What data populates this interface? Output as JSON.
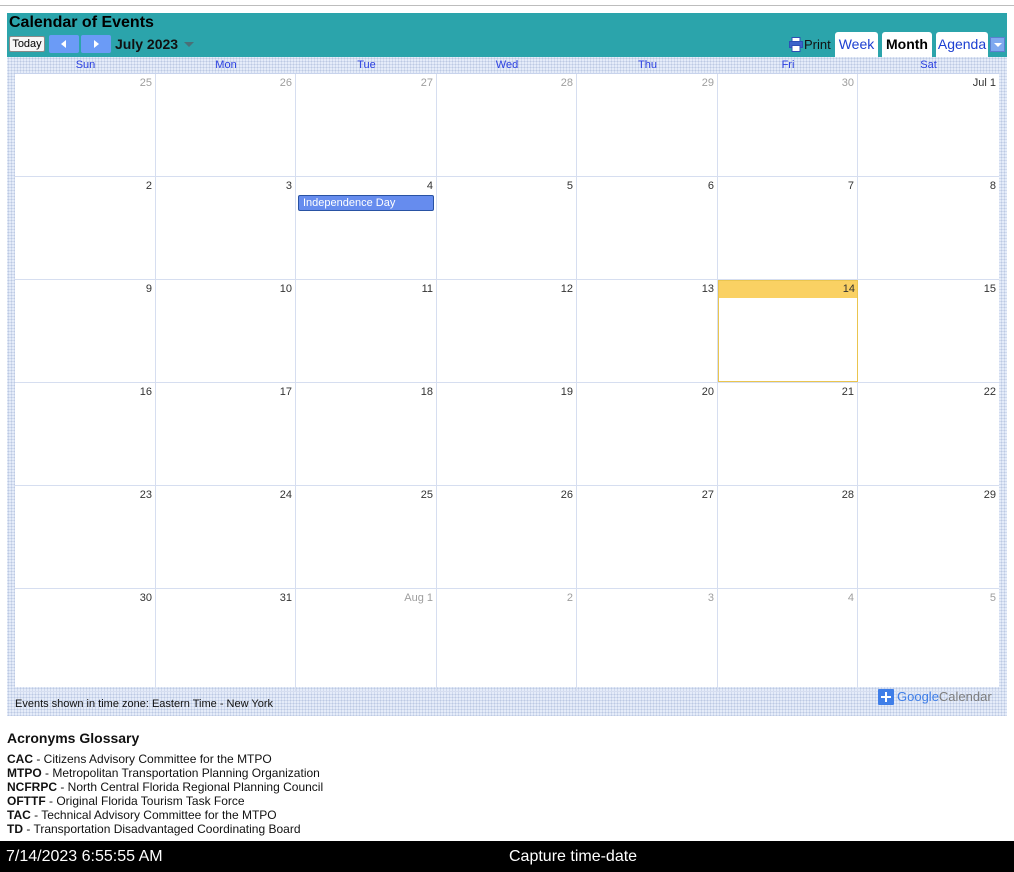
{
  "calendar": {
    "title": "Calendar of Events",
    "today_label": "Today",
    "month_label": "July 2023",
    "print_label": "Print",
    "tabs": [
      {
        "label": "Week",
        "active": false
      },
      {
        "label": "Month",
        "active": true
      },
      {
        "label": "Agenda",
        "active": false
      }
    ],
    "weekdays": [
      "Sun",
      "Mon",
      "Tue",
      "Wed",
      "Thu",
      "Fri",
      "Sat"
    ],
    "weeks": [
      [
        {
          "n": "25",
          "other": true
        },
        {
          "n": "26",
          "other": true
        },
        {
          "n": "27",
          "other": true
        },
        {
          "n": "28",
          "other": true
        },
        {
          "n": "29",
          "other": true
        },
        {
          "n": "30",
          "other": true
        },
        {
          "n": "Jul 1",
          "other": false
        }
      ],
      [
        {
          "n": "2"
        },
        {
          "n": "3"
        },
        {
          "n": "4",
          "event": "Independence Day"
        },
        {
          "n": "5"
        },
        {
          "n": "6"
        },
        {
          "n": "7"
        },
        {
          "n": "8"
        }
      ],
      [
        {
          "n": "9"
        },
        {
          "n": "10"
        },
        {
          "n": "11"
        },
        {
          "n": "12"
        },
        {
          "n": "13"
        },
        {
          "n": "14",
          "today": true
        },
        {
          "n": "15"
        }
      ],
      [
        {
          "n": "16"
        },
        {
          "n": "17"
        },
        {
          "n": "18"
        },
        {
          "n": "19"
        },
        {
          "n": "20"
        },
        {
          "n": "21"
        },
        {
          "n": "22"
        }
      ],
      [
        {
          "n": "23"
        },
        {
          "n": "24"
        },
        {
          "n": "25"
        },
        {
          "n": "26"
        },
        {
          "n": "27"
        },
        {
          "n": "28"
        },
        {
          "n": "29"
        }
      ],
      [
        {
          "n": "30"
        },
        {
          "n": "31"
        },
        {
          "n": "Aug 1",
          "other": true
        },
        {
          "n": "2",
          "other": true
        },
        {
          "n": "3",
          "other": true
        },
        {
          "n": "4",
          "other": true
        },
        {
          "n": "5",
          "other": true
        }
      ]
    ],
    "timezone_note": "Events shown in time zone: Eastern Time - New York",
    "badge_google": "Google",
    "badge_calendar": "Calendar"
  },
  "colors": {
    "header_teal": "#2ba4ab",
    "event_blue": "#668cee",
    "today_yellow": "#fad163",
    "weekday_blue": "#2a3fe0"
  },
  "glossary": {
    "title": "Acronyms Glossary",
    "items": [
      {
        "abbr": "CAC",
        "text": " - Citizens Advisory Committee for the MTPO"
      },
      {
        "abbr": "MTPO",
        "text": " - Metropolitan Transportation Planning Organization"
      },
      {
        "abbr": "NCFRPC",
        "text": " - North Central Florida Regional Planning Council"
      },
      {
        "abbr": "OFTTF",
        "text": " - Original Florida Tourism Task Force"
      },
      {
        "abbr": "TAC",
        "text": " - Technical Advisory Committee for the MTPO"
      },
      {
        "abbr": "TD",
        "text": " - Transportation Disadvantaged Coordinating Board"
      }
    ]
  },
  "capture": {
    "timestamp": "7/14/2023 6:55:55 AM",
    "label": "Capture time-date"
  }
}
